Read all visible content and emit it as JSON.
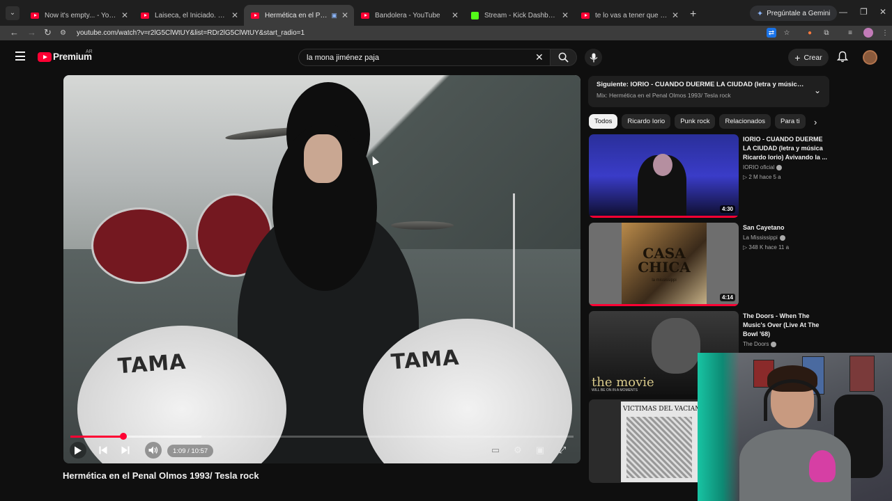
{
  "browser": {
    "tabs": [
      {
        "title": "Now it's empty... - YouTube",
        "icon": "youtube-favicon",
        "active": false
      },
      {
        "title": "Laiseca, el Iniciado. Discípulos",
        "icon": "youtube-favicon",
        "active": false
      },
      {
        "title": "Hermética en el Penal Olmos",
        "icon": "youtube-favicon",
        "active": true
      },
      {
        "title": "Bandolera - YouTube",
        "icon": "youtube-favicon",
        "active": false
      },
      {
        "title": "Stream - Kick Dashboard",
        "icon": "kick-favicon",
        "active": false
      },
      {
        "title": "te lo vas a tener que meter en el",
        "icon": "youtube-favicon",
        "active": false
      }
    ],
    "gemini_label": "Pregúntale a Gemini",
    "url": "youtube.com/watch?v=r2lG5ClWtUY&list=RDr2lG5ClWtUY&start_radio=1"
  },
  "youtube": {
    "logo_text": "Premium",
    "country_code": "AR",
    "search_query": "la mona jiménez paja",
    "create_label": "Crear",
    "colors": {
      "accent": "#ff0033",
      "background": "#0f0f0f"
    }
  },
  "player": {
    "current_time": "1:09",
    "duration": "10:57",
    "time_display": "1:09 / 10:57",
    "progress_fraction": 0.105,
    "buffered_fraction": 0.26,
    "drum_brand": "TAMA"
  },
  "video": {
    "title": "Hermética en el Penal Olmos 1993/ Tesla rock"
  },
  "up_next": {
    "label": "Siguiente: IORIO - CUANDO DUERME LA CIUDAD (letra y música Ricard...",
    "mix": "Mix: Hermética en el Penal Olmos 1993/ Tesla rock"
  },
  "chips": [
    "Todos",
    "Ricardo Iorio",
    "Punk rock",
    "Relacionados",
    "Para ti"
  ],
  "recommendations": [
    {
      "title": "IORIO - CUANDO DUERME LA CIUDAD (letra y música Ricardo Iorio) Avivando la ...",
      "channel": "IORIO oficial",
      "meta": "▷ 2 M  hace 5 a",
      "duration": "4:30",
      "verified": true
    },
    {
      "title": "San Cayetano",
      "channel": "La Mississippi",
      "meta": "▷ 348 K  hace 11 a",
      "duration": "4:14",
      "verified": true,
      "thumb_text": "CASA CHICA",
      "thumb_sub": "la mississippi"
    },
    {
      "title": "The Doors - When The Music's Over (Live At The Bowl '68)",
      "channel": "The Doors",
      "meta": "",
      "duration": "",
      "verified": true,
      "thumb_text": "the movie",
      "thumb_sub": "WILL BE ON IN A MOMENTS"
    },
    {
      "title": "",
      "channel": "",
      "meta": "",
      "duration": "",
      "thumb_text": "VICTIMAS DEL VACIAMIENTO"
    }
  ]
}
